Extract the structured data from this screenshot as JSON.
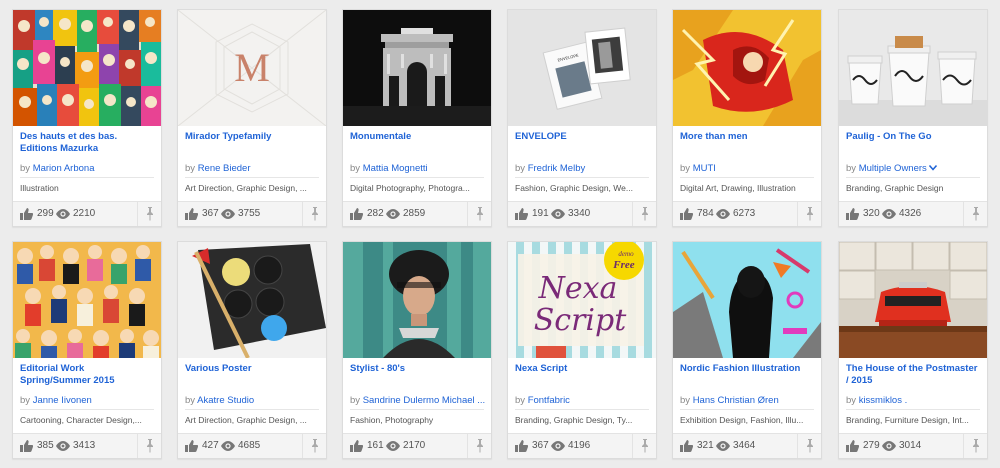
{
  "owner_prefix": "by",
  "projects": [
    {
      "title": "Des hauts et des bas. Editions Mazurka",
      "owner": "Marion Arbona",
      "fields": "Illustration",
      "appreciations": "299",
      "views": "2210"
    },
    {
      "title": "Mirador Typefamily",
      "owner": "Rene Bieder",
      "fields": "Art Direction, Graphic Design, ...",
      "appreciations": "367",
      "views": "3755"
    },
    {
      "title": "Monumentale",
      "owner": "Mattia Mognetti",
      "fields": "Digital Photography, Photogra...",
      "appreciations": "282",
      "views": "2859"
    },
    {
      "title": "ENVELOPE",
      "owner": "Fredrik Melby",
      "fields": "Fashion, Graphic Design, We...",
      "appreciations": "191",
      "views": "3340"
    },
    {
      "title": "More than men",
      "owner": "MUTI",
      "fields": "Digital Art, Drawing, Illustration",
      "appreciations": "784",
      "views": "6273"
    },
    {
      "title": "Paulig - On The Go",
      "owner": "Multiple Owners",
      "fields": "Branding, Graphic Design",
      "appreciations": "320",
      "views": "4326"
    },
    {
      "title": "Editorial Work Spring/Summer 2015",
      "owner": "Janne Iivonen",
      "fields": "Cartooning, Character Design,...",
      "appreciations": "385",
      "views": "3413"
    },
    {
      "title": "Various Poster",
      "owner": "Akatre Studio",
      "fields": "Art Direction, Graphic Design, ...",
      "appreciations": "427",
      "views": "4685"
    },
    {
      "title": "Stylist - 80's",
      "owner": "Sandrine Dulermo Michael ...",
      "fields": "Fashion, Photography",
      "appreciations": "161",
      "views": "2170"
    },
    {
      "title": "Nexa Script",
      "owner": "Fontfabric",
      "fields": "Branding, Graphic Design, Ty...",
      "appreciations": "367",
      "views": "4196"
    },
    {
      "title": "Nordic Fashion Illustration",
      "owner": "Hans Christian Øren",
      "fields": "Exhibition Design, Fashion, Illu...",
      "appreciations": "321",
      "views": "3464"
    },
    {
      "title": "The House of the Postmaster / 2015",
      "owner": "kissmiklos .",
      "fields": "Branding, Furniture Design, Int...",
      "appreciations": "279",
      "views": "3014"
    }
  ],
  "thumbs": {
    "mirador_letter": "M",
    "nexa_line1": "Nexa",
    "nexa_line2": "Script",
    "nexa_badge1": "demo",
    "nexa_badge2": "Free",
    "envelope_text": "ENVELOPE"
  },
  "colors": {
    "link": "#1f63d6",
    "stats_bg": "#f4f4f4",
    "page_bg": "#ececec"
  }
}
